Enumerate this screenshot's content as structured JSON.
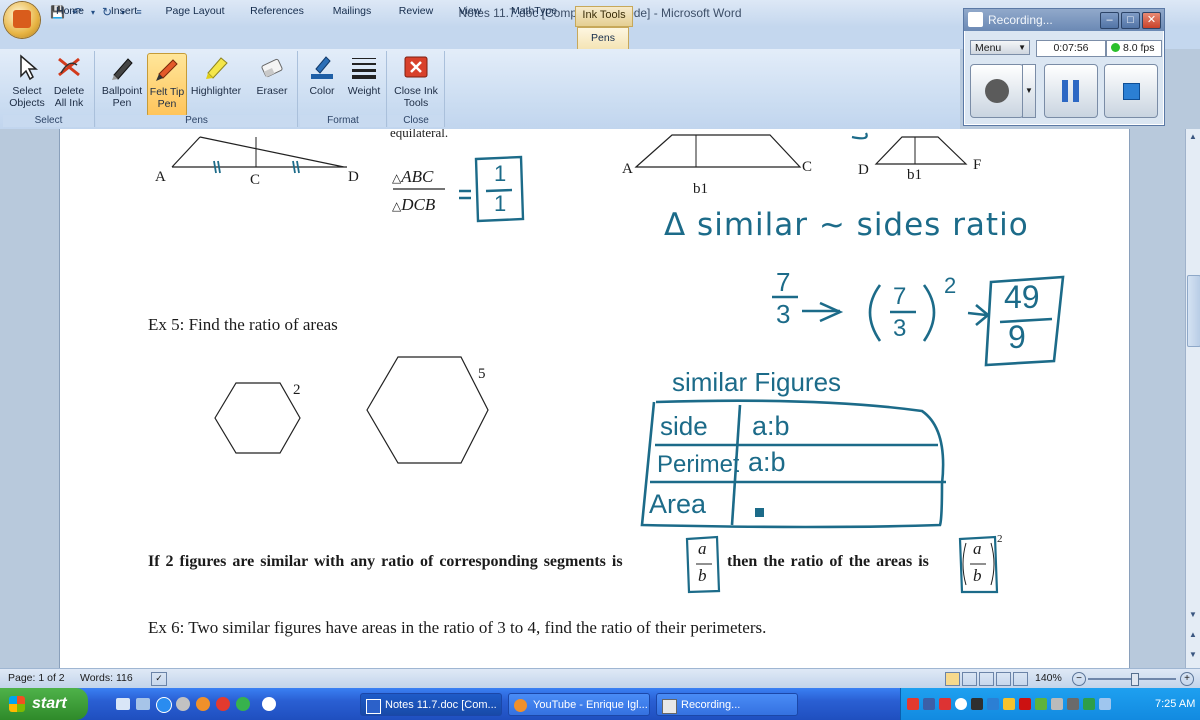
{
  "window": {
    "title": "Notes 11.7.doc [Compatibility Mode] - Microsoft Word",
    "context_tab_group": "Ink Tools"
  },
  "tabs": [
    "Home",
    "Insert",
    "Page Layout",
    "References",
    "Mailings",
    "Review",
    "View",
    "MathType",
    "Pens"
  ],
  "active_tab": "Pens",
  "ribbon": {
    "select_group": {
      "label": "Select",
      "buttons": [
        "Select Objects",
        "Delete All Ink"
      ]
    },
    "pens_group": {
      "label": "Pens",
      "buttons": [
        "Ballpoint Pen",
        "Felt Tip Pen",
        "Highlighter",
        "Eraser"
      ],
      "active": "Felt Tip Pen"
    },
    "format_group": {
      "label": "Format",
      "buttons": [
        "Color",
        "Weight"
      ]
    },
    "close_group": {
      "label": "Close",
      "buttons": [
        "Close Ink Tools"
      ]
    }
  },
  "recorder": {
    "title": "Recording...",
    "menu_label": "Menu",
    "elapsed": "0:07:56",
    "fps": "8.0 fps"
  },
  "document": {
    "top_fragment": {
      "labels_left": [
        "A",
        "C",
        "D"
      ],
      "ratio_top": "ABC",
      "ratio_bottom": "DCB",
      "ratio_value_top": "1",
      "ratio_value_bottom": "1",
      "truncated_text": "equilateral.",
      "labels_mid": [
        "A",
        "b1",
        "C"
      ],
      "labels_right": [
        "D",
        "b1",
        "F"
      ]
    },
    "ink_notes": {
      "line1": "Δ similar ~ sides ratio",
      "frac_num": "7",
      "frac_den": "3",
      "result_num": "49",
      "result_den": "9",
      "exponent": "2",
      "table_title": "similar Figures",
      "table_rows": [
        {
          "label": "side",
          "value": "a:b"
        },
        {
          "label": "Perimeter",
          "value": "a:b"
        },
        {
          "label": "Area",
          "value": ""
        }
      ]
    },
    "ex5": {
      "text": "Ex 5:  Find the ratio of areas",
      "small_hexagon_side": "2",
      "large_hexagon_side": "5"
    },
    "theorem": {
      "part1": "If 2 figures are similar with any ratio of corresponding segments is",
      "frac_a": "a",
      "frac_b": "b",
      "part2": "then the ratio of the areas is",
      "exponent": "2"
    },
    "ex6": {
      "text": "Ex 6:  Two similar figures have areas in the ratio of 3 to 4, find the ratio of their perimeters."
    }
  },
  "statusbar": {
    "page": "Page: 1 of 2",
    "words": "Words: 116",
    "zoom": "140%"
  },
  "taskbar": {
    "start_label": "start",
    "tasks": [
      "Notes 11.7.doc [Com...",
      "YouTube - Enrique Igl...",
      "Recording..."
    ],
    "clock": "7:25 AM"
  }
}
